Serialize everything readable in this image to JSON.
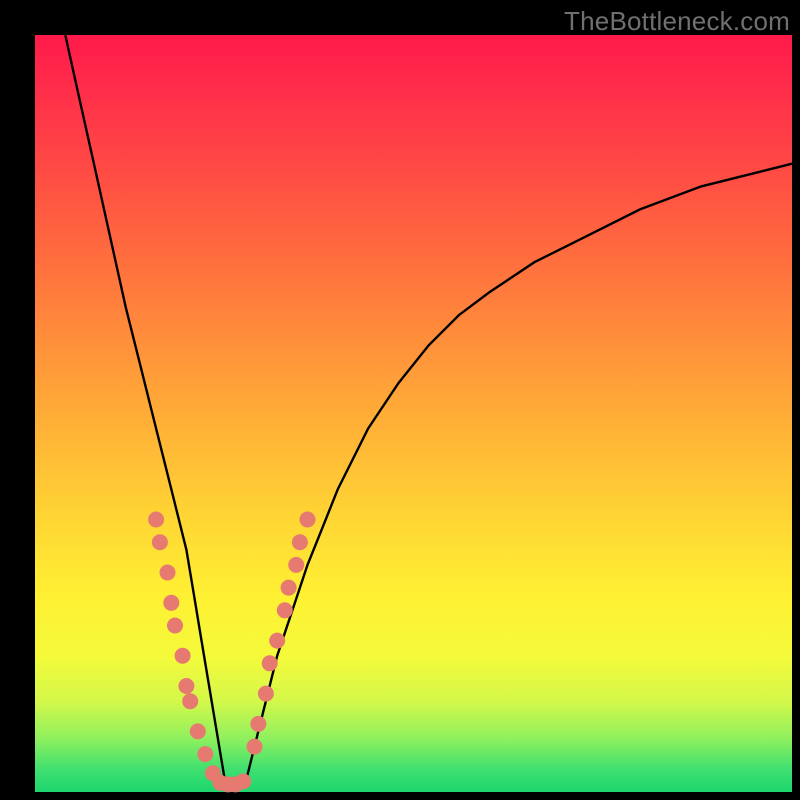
{
  "watermark": "TheBottleneck.com",
  "colors": {
    "gradient_top": "#ff1a4a",
    "gradient_mid1": "#ff943a",
    "gradient_mid2": "#fff033",
    "gradient_bottom": "#1dd66e",
    "curve": "#000000",
    "markers": "#e77a70",
    "frame": "#000000"
  },
  "chart_data": {
    "type": "line",
    "title": "",
    "xlabel": "",
    "ylabel": "",
    "xlim": [
      0,
      100
    ],
    "ylim": [
      0,
      100
    ],
    "note": "V-shaped bottleneck curve; y≈0 around x≈25; markers highlight the lower part of both branches",
    "series": [
      {
        "name": "curve",
        "x": [
          4,
          6,
          8,
          10,
          12,
          14,
          16,
          18,
          20,
          21,
          22,
          23,
          24,
          25,
          26,
          27,
          28,
          29,
          30,
          32,
          34,
          36,
          38,
          40,
          44,
          48,
          52,
          56,
          60,
          66,
          72,
          80,
          88,
          96,
          100
        ],
        "y": [
          100,
          91,
          82,
          73,
          64,
          56,
          48,
          40,
          32,
          26,
          20,
          14,
          8,
          2,
          1,
          1,
          2,
          6,
          10,
          18,
          24,
          30,
          35,
          40,
          48,
          54,
          59,
          63,
          66,
          70,
          73,
          77,
          80,
          82,
          83
        ]
      }
    ],
    "markers": {
      "left_branch": [
        {
          "x": 16.0,
          "y": 36
        },
        {
          "x": 16.5,
          "y": 33
        },
        {
          "x": 17.5,
          "y": 29
        },
        {
          "x": 18.0,
          "y": 25
        },
        {
          "x": 18.5,
          "y": 22
        },
        {
          "x": 19.5,
          "y": 18
        },
        {
          "x": 20.0,
          "y": 14
        },
        {
          "x": 20.5,
          "y": 12
        },
        {
          "x": 21.5,
          "y": 8
        },
        {
          "x": 22.5,
          "y": 5
        },
        {
          "x": 23.5,
          "y": 2.5
        }
      ],
      "bottom": [
        {
          "x": 24.5,
          "y": 1.2
        },
        {
          "x": 25.5,
          "y": 1.0
        },
        {
          "x": 26.5,
          "y": 1.0
        },
        {
          "x": 27.5,
          "y": 1.4
        }
      ],
      "right_branch": [
        {
          "x": 29.0,
          "y": 6
        },
        {
          "x": 29.5,
          "y": 9
        },
        {
          "x": 30.5,
          "y": 13
        },
        {
          "x": 31.0,
          "y": 17
        },
        {
          "x": 32.0,
          "y": 20
        },
        {
          "x": 33.0,
          "y": 24
        },
        {
          "x": 33.5,
          "y": 27
        },
        {
          "x": 34.5,
          "y": 30
        },
        {
          "x": 35.0,
          "y": 33
        },
        {
          "x": 36.0,
          "y": 36
        }
      ]
    }
  }
}
